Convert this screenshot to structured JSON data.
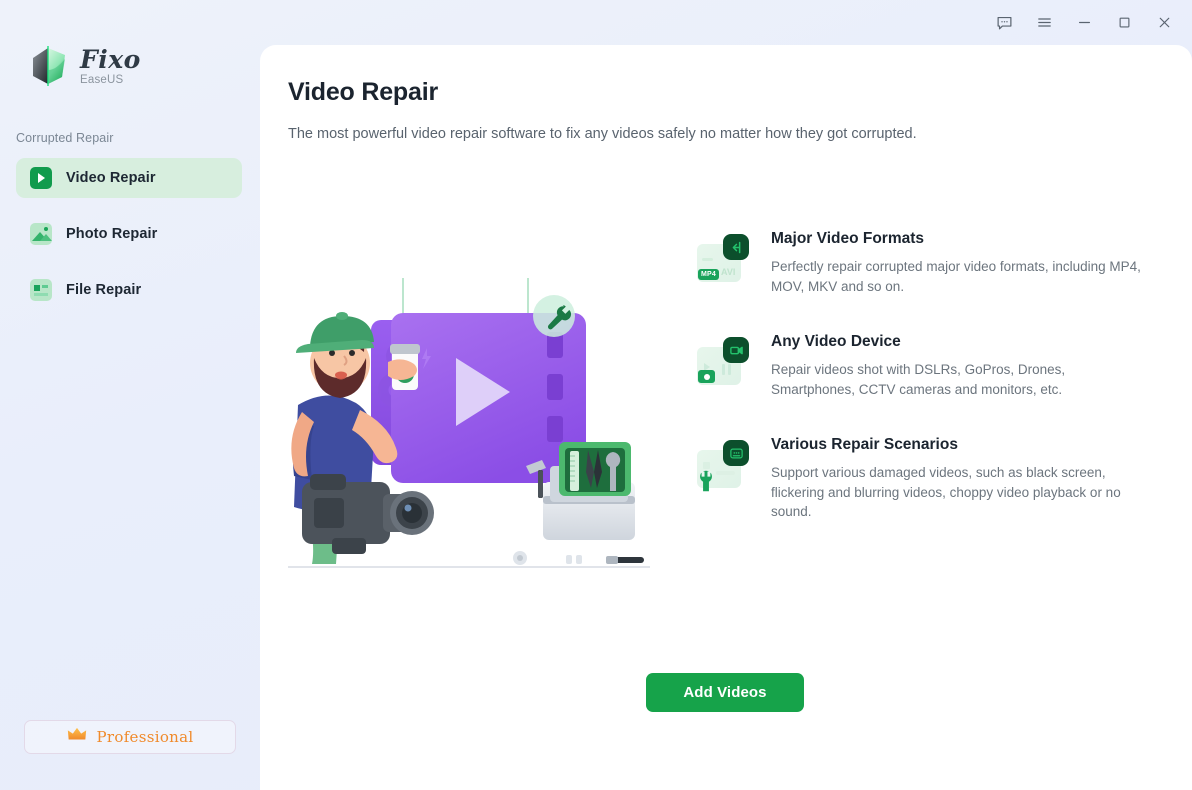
{
  "window": {
    "controls": [
      {
        "name": "feedback-icon",
        "label": "Feedback"
      },
      {
        "name": "menu-icon",
        "label": "Menu"
      },
      {
        "name": "minimize-icon",
        "label": "Minimize"
      },
      {
        "name": "maximize-icon",
        "label": "Maximize"
      },
      {
        "name": "close-icon",
        "label": "Close"
      }
    ]
  },
  "sidebar": {
    "brand": {
      "name": "Fixo",
      "sub": "EaseUS",
      "logo_icon": "fixo-logo-icon"
    },
    "section_label": "Corrupted Repair",
    "items": [
      {
        "label": "Video Repair",
        "icon": "video-repair-icon",
        "active": true
      },
      {
        "label": "Photo Repair",
        "icon": "photo-repair-icon",
        "active": false
      },
      {
        "label": "File Repair",
        "icon": "file-repair-icon",
        "active": false
      }
    ],
    "professional": {
      "label": "Professional",
      "icon": "crown-icon"
    }
  },
  "main": {
    "title": "Video Repair",
    "subtitle": "The most powerful video repair software to fix any videos safely no matter how they got corrupted.",
    "illustration": "video-repair-illustration",
    "features": [
      {
        "icon": "video-formats-icon",
        "title": "Major Video Formats",
        "desc": "Perfectly repair corrupted major video formats, including MP4, MOV, MKV and so on.",
        "tag_primary": "MP4",
        "tag_secondary": "AVI"
      },
      {
        "icon": "video-device-icon",
        "title": "Any Video Device",
        "desc": "Repair videos shot with DSLRs, GoPros, Drones, Smartphones, CCTV cameras and monitors, etc."
      },
      {
        "icon": "repair-scenarios-icon",
        "title": "Various Repair Scenarios",
        "desc": "Support various damaged videos, such as black screen, flickering and blurring videos, choppy video playback or no sound."
      }
    ],
    "cta": {
      "label": "Add Videos"
    }
  },
  "colors": {
    "accent_green": "#16a34a",
    "dark_green": "#0c4f2c",
    "active_nav_bg": "#d7eede",
    "pro_orange": "#f08a2b",
    "page_bg": "#eef2fa",
    "panel_bg": "#ffffff"
  }
}
